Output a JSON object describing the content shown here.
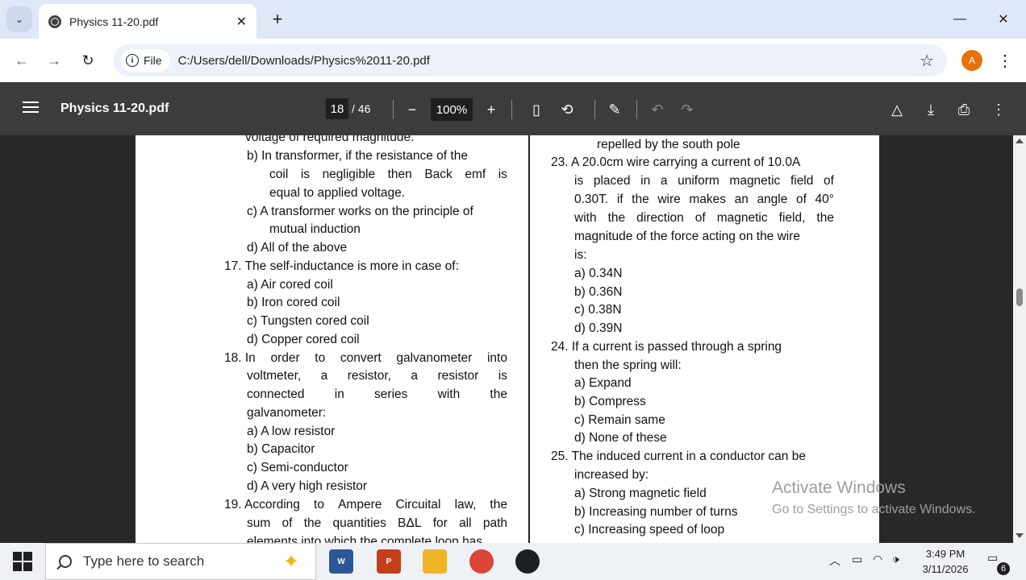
{
  "browser": {
    "tab_title": "Physics 11-20.pdf",
    "tab_close": "✕",
    "new_tab": "+",
    "url_chip": "File",
    "url": "C:/Users/dell/Downloads/Physics%2011-20.pdf",
    "avatar_letter": "A"
  },
  "pdf_toolbar": {
    "title": "Physics 11-20.pdf",
    "current_page": "18",
    "total_pages": "/ 46",
    "zoom": "100%"
  },
  "document": {
    "left_column": [
      "voltage of required magnitude.",
      "b)  In transformer, if the resistance of the",
      "coil is negligible then Back emf is",
      "equal to applied voltage.",
      "c)  A transformer works on the principle of",
      "mutual induction",
      "d)  All of the above",
      "17. The self-inductance is more in case of:",
      "a)  Air cored coil",
      "b)  Iron cored coil",
      "c)  Tungsten cored coil",
      "d)  Copper cored coil",
      "18. In order to convert galvanometer into",
      "voltmeter, a resistor, a resistor is",
      "connected in series with the",
      "galvanometer:",
      "a)  A low resistor",
      "b)  Capacitor",
      "c)  Semi-conductor",
      "d)  A very high resistor",
      "19. According to Ampere Circuital law, the",
      "sum of the quantities BΔL for all path",
      "elements into which the complete loop has"
    ],
    "right_column": [
      "repelled by the south pole",
      "23. A 20.0cm wire carrying a current of 10.0A",
      "is placed in a uniform magnetic field of",
      "0.30T. if the wire makes an angle of 40°",
      "with the direction of magnetic field, the",
      "magnitude of the force acting on the wire",
      "is:",
      "a)  0.34N",
      "b)  0.36N",
      "c)  0.38N",
      "d)  0.39N",
      "24. If a current is passed through a spring",
      "then the spring will:",
      "a)  Expand",
      "b)  Compress",
      "c)  Remain same",
      "d)  None of these",
      "25. The induced current in a conductor can be",
      "increased by:",
      "a)  Strong magnetic field",
      "b)  Increasing number of turns",
      "c)  Increasing speed of loop"
    ]
  },
  "watermark": {
    "line1": "Activate Windows",
    "line2": "Go to Settings to activate Windows."
  },
  "taskbar": {
    "search_placeholder": "Type here to search",
    "time": "3:49 PM",
    "date": "3/11/2026",
    "notification_count": "6"
  }
}
